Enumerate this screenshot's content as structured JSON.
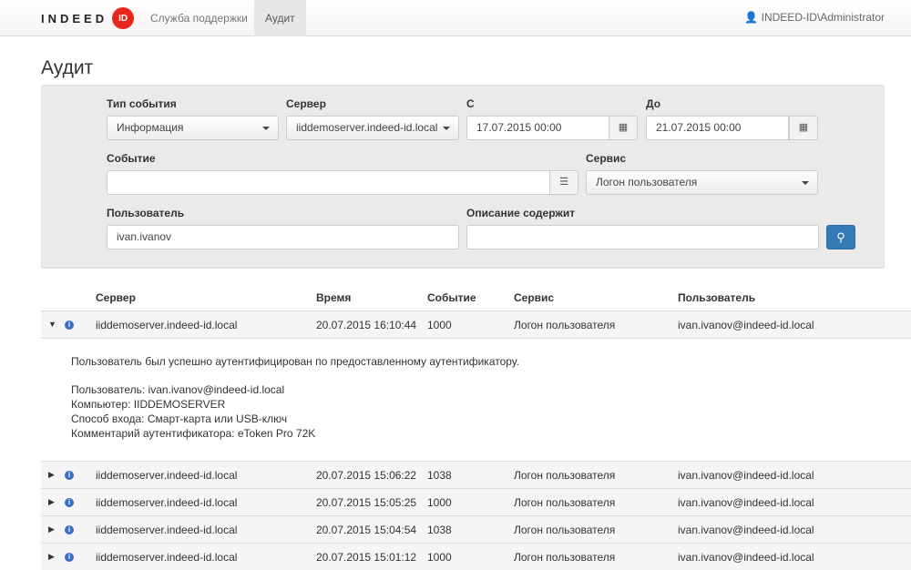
{
  "nav": {
    "logo_text": "INDEED",
    "logo_badge": "ID",
    "links": [
      "Служба поддержки",
      "Аудит"
    ],
    "user": "INDEED-ID\\Administrator"
  },
  "title": "Аудит",
  "filters": {
    "event_type_label": "Тип события",
    "event_type": "Информация",
    "server_label": "Сервер",
    "server": "iiddemoserver.indeed-id.local",
    "from_label": "С",
    "from": "17.07.2015 00:00",
    "to_label": "До",
    "to": "21.07.2015 00:00",
    "event_label": "Событие",
    "event": "",
    "service_label": "Сервис",
    "service": "Логон пользователя",
    "user_label": "Пользователь",
    "user": "ivan.ivanov",
    "desc_label": "Описание содержит",
    "desc": ""
  },
  "table": {
    "headers": [
      "Сервер",
      "Время",
      "Событие",
      "Сервис",
      "Пользователь"
    ],
    "rows": [
      [
        "iiddemoserver.indeed-id.local",
        "20.07.2015 16:10:44",
        "1000",
        "Логон пользователя",
        "ivan.ivanov@indeed-id.local"
      ],
      [
        "iiddemoserver.indeed-id.local",
        "20.07.2015 15:06:22",
        "1038",
        "Логон пользователя",
        "ivan.ivanov@indeed-id.local"
      ],
      [
        "iiddemoserver.indeed-id.local",
        "20.07.2015 15:05:25",
        "1000",
        "Логон пользователя",
        "ivan.ivanov@indeed-id.local"
      ],
      [
        "iiddemoserver.indeed-id.local",
        "20.07.2015 15:04:54",
        "1038",
        "Логон пользователя",
        "ivan.ivanov@indeed-id.local"
      ],
      [
        "iiddemoserver.indeed-id.local",
        "20.07.2015 15:01:12",
        "1000",
        "Логон пользователя",
        "ivan.ivanov@indeed-id.local"
      ]
    ],
    "detail": [
      "Пользователь был успешно аутентифицирован по предоставленному аутентификатору.",
      "Пользователь: ivan.ivanov@indeed-id.local",
      "Компьютер: IIDDEMOSERVER",
      "Способ входа: Смарт-карта или USB-ключ",
      "Комментарий аутентификатора: eToken Pro 72K"
    ]
  }
}
